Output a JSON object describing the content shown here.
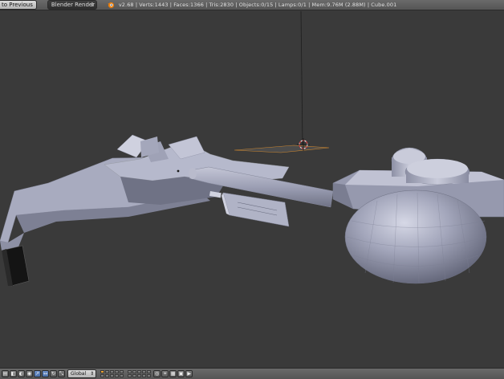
{
  "header": {
    "back_button": "to Previous",
    "render_engine": "Blender Render",
    "stats": "v2.68 | Verts:1443 | Faces:1366 | Tris:2830 | Objects:0/15 | Lamps:0/1 | Mem:9.76M (2.88M) | Cube.001"
  },
  "view_header": {
    "orientation": "Global",
    "icons": [
      "view-menu-icon",
      "object-mode-icon",
      "shading-icon",
      "pivot-icon",
      "manipulator-icon",
      "translate-icon",
      "rotate-icon",
      "scale-icon",
      "layers-icon",
      "snap-icon",
      "render-icon"
    ]
  },
  "colors": {
    "viewport_bg": "#3a3a3a",
    "header_bg": "#5e5e5e",
    "mesh_light": "#b0b3c8",
    "mesh_dark": "#6c6f82",
    "accent_blue": "#5680c2",
    "layer_active": "#e8a030"
  }
}
